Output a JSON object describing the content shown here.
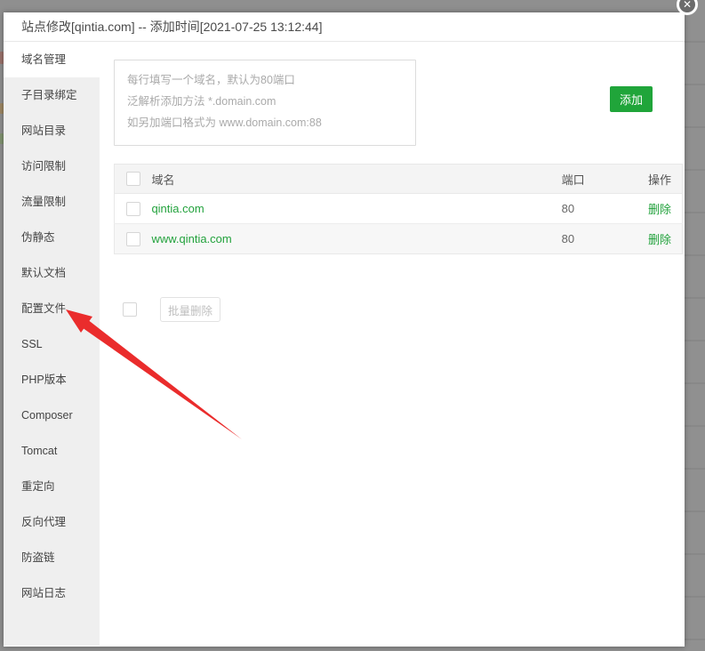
{
  "window": {
    "title": "站点修改[qintia.com] -- 添加时间[2021-07-25 13:12:44]"
  },
  "icons": {
    "close": "✕"
  },
  "sidebar": {
    "active_item": "域名管理",
    "items": [
      {
        "label": "域名管理"
      },
      {
        "label": "子目录绑定"
      },
      {
        "label": "网站目录"
      },
      {
        "label": "访问限制"
      },
      {
        "label": "流量限制"
      },
      {
        "label": "伪静态"
      },
      {
        "label": "默认文档"
      },
      {
        "label": "配置文件"
      },
      {
        "label": "SSL"
      },
      {
        "label": "PHP版本"
      },
      {
        "label": "Composer"
      },
      {
        "label": "Tomcat"
      },
      {
        "label": "重定向"
      },
      {
        "label": "反向代理"
      },
      {
        "label": "防盗链"
      },
      {
        "label": "网站日志"
      }
    ]
  },
  "main": {
    "domain_input": {
      "value": "",
      "placeholder": "每行填写一个域名，默认为80端口\n泛解析添加方法 *.domain.com\n如另加端口格式为 www.domain.com:88"
    },
    "add_button_label": "添加",
    "table": {
      "headers": {
        "domain": "域名",
        "port": "端口",
        "action": "操作"
      },
      "rows": [
        {
          "domain": "qintia.com",
          "port": "80",
          "action": "删除"
        },
        {
          "domain": "www.qintia.com",
          "port": "80",
          "action": "删除"
        }
      ]
    },
    "batch_delete_label": "批量删除"
  },
  "annotation": {
    "arrow_color": "#ea2c2c",
    "arrow_points_to": "配置文件"
  },
  "colors": {
    "accent_green": "#20a53a",
    "link_green": "#23a23d",
    "overlay_gray": "#8f8f8f"
  }
}
